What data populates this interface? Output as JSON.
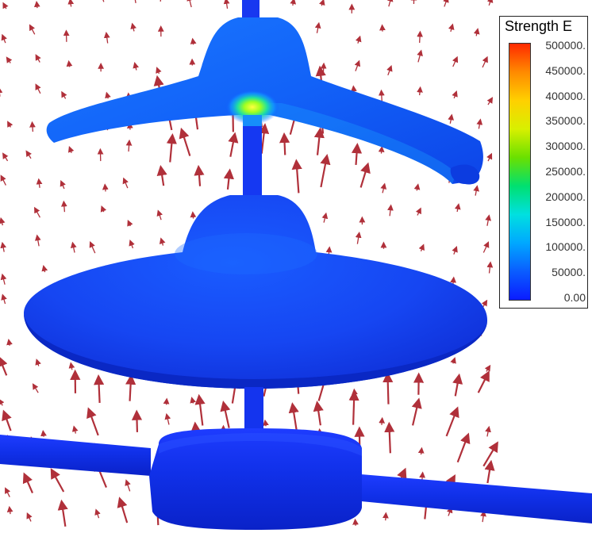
{
  "legend": {
    "title": "Strength E",
    "ticks": [
      "500000.",
      "450000.",
      "400000.",
      "350000.",
      "300000.",
      "250000.",
      "200000.",
      "150000.",
      "100000.",
      "50000.",
      "0.00"
    ],
    "colorscale": [
      "#0b1cff",
      "#0a5dff",
      "#00a8ff",
      "#00e0e0",
      "#00e070",
      "#6ae000",
      "#d8f000",
      "#ffd000",
      "#ff8a00",
      "#ff2a00"
    ]
  },
  "colors": {
    "insulator": "#1436f0",
    "arrow": "#b0303a"
  }
}
